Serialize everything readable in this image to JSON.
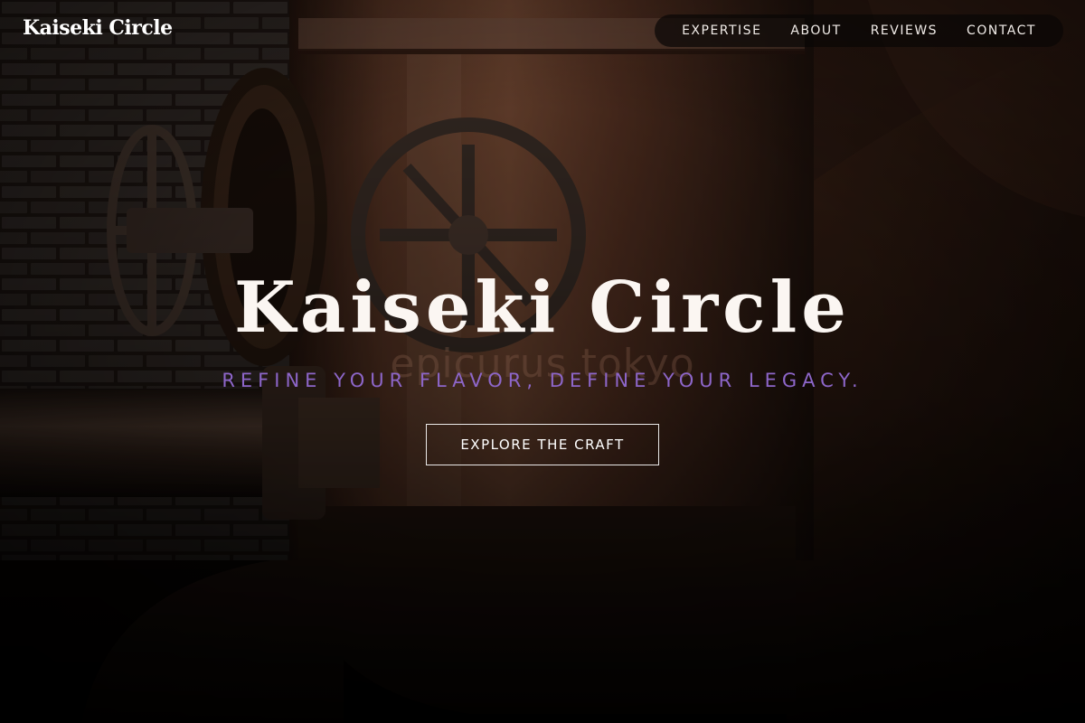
{
  "header": {
    "logo_text": "Kaiseki Circle"
  },
  "nav": {
    "items": [
      {
        "label": "EXPERTISE"
      },
      {
        "label": "ABOUT"
      },
      {
        "label": "REVIEWS"
      },
      {
        "label": "CONTACT"
      }
    ]
  },
  "hero": {
    "title": "Kaiseki Circle",
    "background_watermark": "epicurus tokyo",
    "tagline": "REFINE YOUR FLAVOR, DEFINE YOUR LEGACY.",
    "cta_label": "EXPLORE THE CRAFT"
  },
  "colors": {
    "tagline": "#8d66c9",
    "text": "#ffffff",
    "background": "#0d0806",
    "copper": "#6a3f2a"
  }
}
